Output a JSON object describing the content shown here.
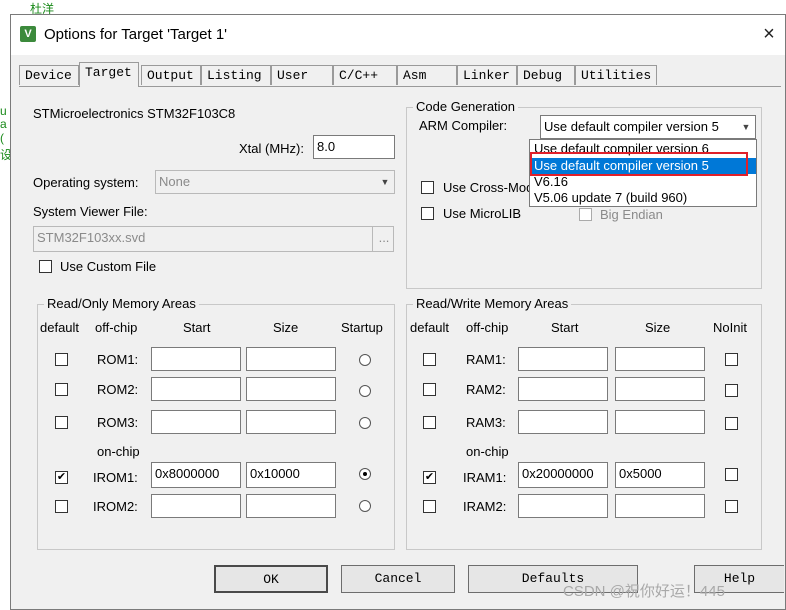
{
  "background_code": [
    "杜洋",
    "u",
    "a",
    "(",
    "设"
  ],
  "window": {
    "title": "Options for Target 'Target 1'",
    "close": "×",
    "icon": "V"
  },
  "tabs": [
    "Device",
    "Target",
    "Output",
    "Listing",
    "User",
    "C/C++",
    "Asm",
    "Linker",
    "Debug",
    "Utilities"
  ],
  "active_tab": "Target",
  "device": {
    "name": "STMicroelectronics STM32F103C8",
    "xtal_label": "Xtal (MHz):",
    "xtal_value": "8.0"
  },
  "os": {
    "label": "Operating system:",
    "value": "None"
  },
  "svd": {
    "label": "System Viewer File:",
    "value": "STM32F103xx.svd",
    "browse": "...",
    "custom_label": "Use Custom File"
  },
  "code_gen": {
    "title": "Code Generation",
    "compiler_label": "ARM Compiler:",
    "compiler_value": "Use default compiler version 5",
    "options": [
      "Use default compiler version 6",
      "Use default compiler version 5",
      "V6.16",
      "V5.06 update 7 (build 960)"
    ],
    "selected_index": 1,
    "cross_module_label": "Use Cross-Modu",
    "microlib_label": "Use MicroLIB",
    "big_endian_label": "Big Endian"
  },
  "rom": {
    "title": "Read/Only Memory Areas",
    "headers": {
      "default": "default",
      "offchip": "off-chip",
      "start": "Start",
      "size": "Size",
      "extra": "Startup"
    },
    "onchip_label": "on-chip",
    "rows": [
      {
        "label": "ROM1:",
        "start": "",
        "size": "",
        "default": false,
        "startup": false
      },
      {
        "label": "ROM2:",
        "start": "",
        "size": "",
        "default": false,
        "startup": false
      },
      {
        "label": "ROM3:",
        "start": "",
        "size": "",
        "default": false,
        "startup": false
      },
      {
        "label": "IROM1:",
        "start": "0x8000000",
        "size": "0x10000",
        "default": true,
        "startup": true
      },
      {
        "label": "IROM2:",
        "start": "",
        "size": "",
        "default": false,
        "startup": false
      }
    ]
  },
  "ram": {
    "title": "Read/Write Memory Areas",
    "headers": {
      "default": "default",
      "offchip": "off-chip",
      "start": "Start",
      "size": "Size",
      "extra": "NoInit"
    },
    "onchip_label": "on-chip",
    "rows": [
      {
        "label": "RAM1:",
        "start": "",
        "size": "",
        "default": false,
        "noinit": false
      },
      {
        "label": "RAM2:",
        "start": "",
        "size": "",
        "default": false,
        "noinit": false
      },
      {
        "label": "RAM3:",
        "start": "",
        "size": "",
        "default": false,
        "noinit": false
      },
      {
        "label": "IRAM1:",
        "start": "0x20000000",
        "size": "0x5000",
        "default": true,
        "noinit": false
      },
      {
        "label": "IRAM2:",
        "start": "",
        "size": "",
        "default": false,
        "noinit": false
      }
    ]
  },
  "buttons": {
    "ok": "OK",
    "cancel": "Cancel",
    "defaults": "Defaults",
    "help": "Help"
  },
  "watermark": "CSDN @祝你好运！445",
  "colors": {
    "selection": "#0078d7",
    "highlight_box": "#e0202a",
    "dialog_bg": "#f0f0f0"
  }
}
